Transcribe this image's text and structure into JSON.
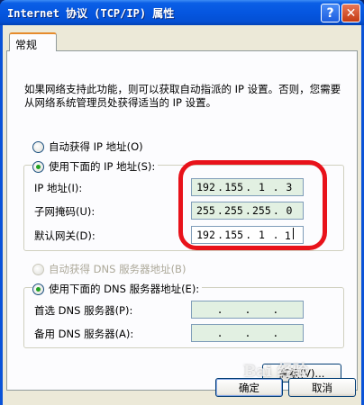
{
  "window": {
    "title": "Internet 协议 (TCP/IP) 属性",
    "help_glyph": "?",
    "close_glyph": "✕"
  },
  "tabs": [
    {
      "label": "常规"
    }
  ],
  "description": "如果网络支持此功能，则可以获取自动指派的 IP 设置。否则，您需要从网络系统管理员处获得适当的 IP 设置。",
  "ip_mode": {
    "auto": {
      "label": "自动获得 IP 地址(O)",
      "checked": false
    },
    "manual": {
      "label": "使用下面的 IP 地址(S):",
      "checked": true
    }
  },
  "ip_fields": [
    {
      "label": "IP 地址(I):",
      "octets": [
        "192",
        "155",
        "1",
        "3"
      ]
    },
    {
      "label": "子网掩码(U):",
      "octets": [
        "255",
        "255",
        "255",
        "0"
      ]
    },
    {
      "label": "默认网关(D):",
      "octets": [
        "192",
        "155",
        "1",
        "1"
      ]
    }
  ],
  "dns_mode": {
    "auto": {
      "label": "自动获得 DNS 服务器地址(B)",
      "checked": false,
      "disabled": true
    },
    "manual": {
      "label": "使用下面的 DNS 服务器地址(E):",
      "checked": true
    }
  },
  "dns_fields": [
    {
      "label": "首选 DNS 服务器(P):",
      "octets": [
        "",
        "",
        "",
        ""
      ]
    },
    {
      "label": "备用 DNS 服务器(A):",
      "octets": [
        "",
        "",
        "",
        ""
      ]
    }
  ],
  "buttons": {
    "advanced": "高级(V)...",
    "ok": "确定",
    "cancel": "取消"
  },
  "watermark": "Bai 经验",
  "colors": {
    "highlight_circle": "#e8121a",
    "title_bar": "#0556e0",
    "field_fill": "#e2f0e2"
  }
}
